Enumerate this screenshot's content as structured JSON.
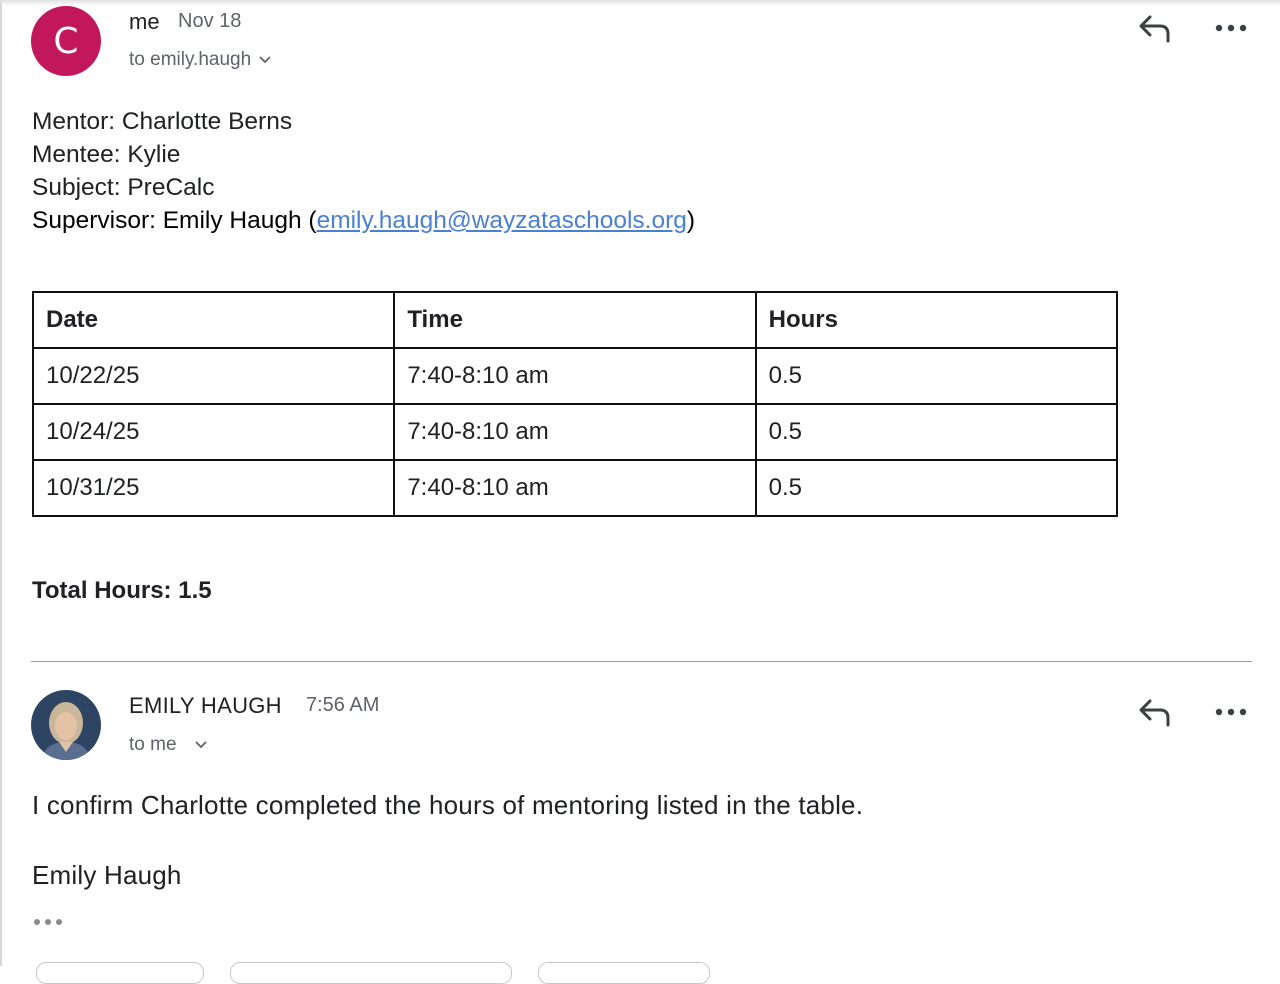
{
  "message1": {
    "avatar_letter": "C",
    "avatar_color": "#c2185b",
    "sender": "me",
    "date": "Nov 18",
    "recipient_line": "to emily.haugh",
    "lines": {
      "mentor": "Mentor: Charlotte Berns",
      "mentee": "Mentee: Kylie",
      "subject": "Subject: PreCalc",
      "supervisor_prefix": "Supervisor: Emily Haugh (",
      "supervisor_email": "emily.haugh@wayzataschools.org",
      "supervisor_suffix": ")"
    },
    "table": {
      "headers": [
        "Date",
        "Time",
        "Hours"
      ],
      "rows": [
        [
          "10/22/25",
          "7:40-8:10 am",
          "0.5"
        ],
        [
          "10/24/25",
          "7:40-8:10 am",
          "0.5"
        ],
        [
          "10/31/25",
          "7:40-8:10 am",
          "0.5"
        ]
      ]
    },
    "total": "Total Hours: 1.5",
    "icons": [
      "reply-icon",
      "more-options-icon"
    ]
  },
  "message2": {
    "sender": "EMILY HAUGH",
    "time": "7:56 AM",
    "recipient_line": "to me",
    "body": "I confirm Charlotte completed the hours of mentoring listed in the table.",
    "signature": "Emily Haugh",
    "icons": [
      "reply-icon",
      "more-options-icon",
      "show-trimmed-content-icon"
    ]
  },
  "colors": {
    "link": "#4a7fd6",
    "secondary_text": "#5f6368"
  }
}
